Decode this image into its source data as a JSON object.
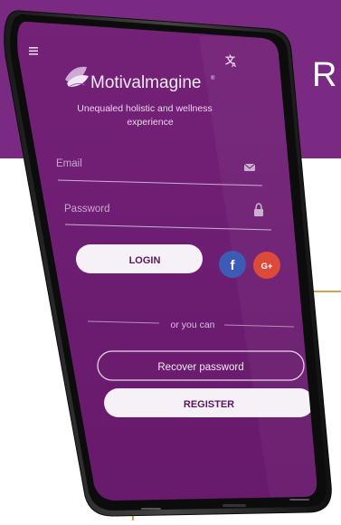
{
  "banner": {
    "letter": "R"
  },
  "app": {
    "brand_name": "Motivalmagine",
    "trademark": "®",
    "tagline_line1": "Unequaled holistic and wellness",
    "tagline_line2": "experience",
    "email_placeholder": "Email",
    "password_placeholder": "Password",
    "login_label": "LOGIN",
    "facebook_label": "f",
    "google_label": "G+",
    "divider_text": "or you can",
    "recover_label": "Recover password",
    "register_label": "REGISTER",
    "icons": {
      "menu": "hamburger-menu-icon",
      "language": "translate-icon",
      "email": "envelope-icon",
      "password": "lock-icon",
      "logo": "leaf-logo-icon"
    }
  },
  "colors": {
    "banner": "#7b2a83",
    "screen": "#6c1d70",
    "facebook": "#3b5bb5",
    "google": "#dd4a3a",
    "accent_gold": "#c7913a"
  }
}
